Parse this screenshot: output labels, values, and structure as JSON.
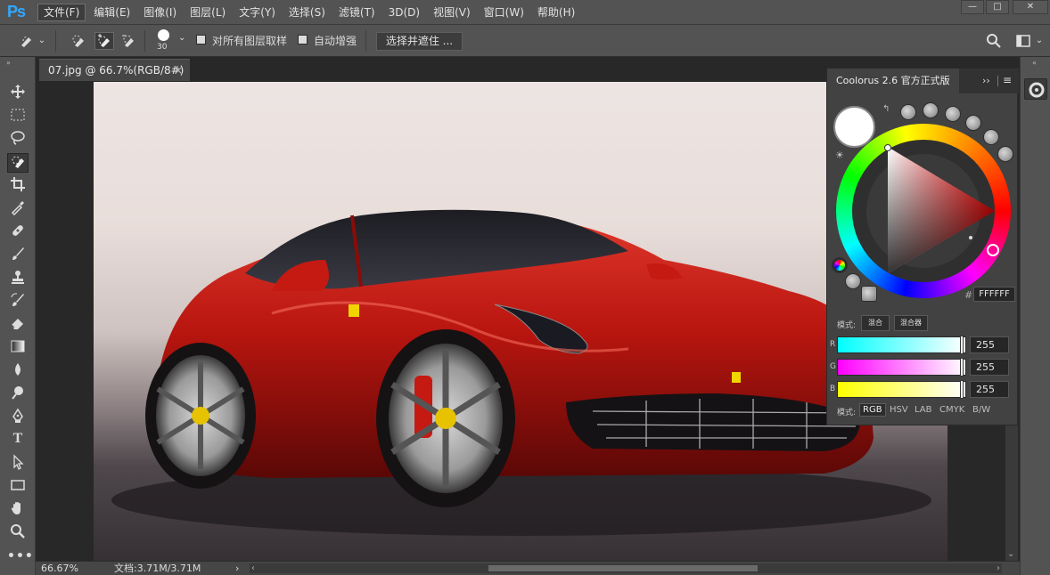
{
  "app": {
    "logo": "Ps",
    "accent": "#31a8ff"
  },
  "menu": [
    "文件(F)",
    "编辑(E)",
    "图像(I)",
    "图层(L)",
    "文字(Y)",
    "选择(S)",
    "滤镜(T)",
    "3D(D)",
    "视图(V)",
    "窗口(W)",
    "帮助(H)"
  ],
  "window_controls": {
    "minimize": "—",
    "maximize": "□",
    "close": "✕"
  },
  "options": {
    "brush_size": "30",
    "sample_all_layers": "对所有图层取样",
    "auto_enhance": "自动增强",
    "refine_button": "选择并遮住 ..."
  },
  "document": {
    "tab_title": "07.jpg @ 66.7%(RGB/8#)",
    "close": "×"
  },
  "tools": [
    "move-tool-icon",
    "marquee-tool-icon",
    "lasso-tool-icon",
    "quick-select-tool-icon",
    "crop-tool-icon",
    "eyedropper-tool-icon",
    "healing-tool-icon",
    "brush-tool-icon",
    "stamp-tool-icon",
    "history-brush-icon",
    "eraser-tool-icon",
    "gradient-tool-icon",
    "blur-tool-icon",
    "dodge-tool-icon",
    "pen-tool-icon",
    "type-tool-icon",
    "path-select-tool-icon",
    "rectangle-tool-icon",
    "hand-tool-icon",
    "zoom-tool-icon",
    "more-tools-icon"
  ],
  "status": {
    "zoom": "66.67%",
    "doc_info": "文档:3.71M/3.71M",
    "arrow": "›"
  },
  "coolorus": {
    "title": "Coolorus 2.6 官方正式版",
    "hex_label": "#",
    "hex_value": "FFFFFF",
    "mode_label": "模式:",
    "btn_a": "混合",
    "btn_b": "混合器",
    "channels": [
      {
        "label": "R",
        "value": "255",
        "gradient": "linear-gradient(90deg,#00ffff,#ffffff)"
      },
      {
        "label": "G",
        "value": "255",
        "gradient": "linear-gradient(90deg,#ff00ff,#ffffff)"
      },
      {
        "label": "B",
        "value": "255",
        "gradient": "linear-gradient(90deg,#ffff00,#ffffff)"
      }
    ],
    "modes": [
      "RGB",
      "HSV",
      "LAB",
      "CMYK",
      "B/W"
    ],
    "active_mode": "RGB",
    "current_color": "#ffffff"
  },
  "colors": {
    "menubar": "#535353",
    "workspace": "#282828",
    "car_red": "#c41a12"
  }
}
